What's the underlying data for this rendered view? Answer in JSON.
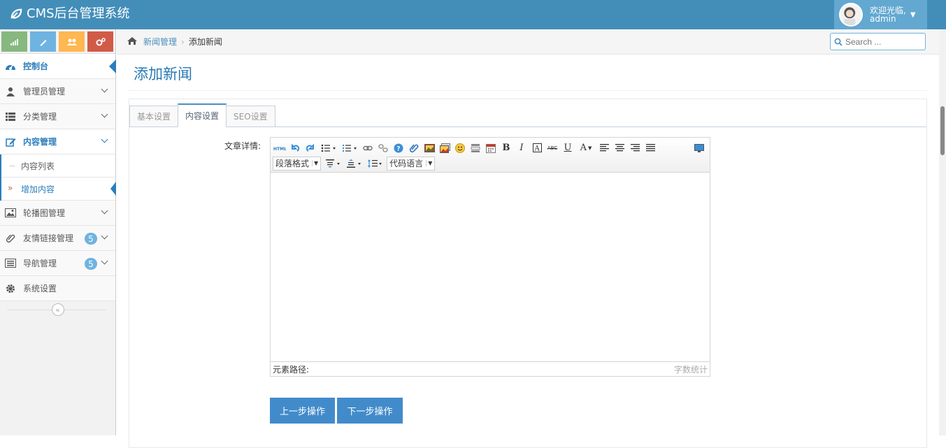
{
  "app": {
    "title": "CMS后台管理系统"
  },
  "user": {
    "greeting": "欢迎光临,",
    "name": "admin"
  },
  "colors": {
    "navbar": "#438eb9",
    "accent": "#2b7dbc",
    "button": "#428bca"
  },
  "shortcuts": [
    {
      "icon": "signal-icon",
      "color": "#87b87f"
    },
    {
      "icon": "pencil-icon",
      "color": "#6fb3e0"
    },
    {
      "icon": "users-icon",
      "color": "#ffb752"
    },
    {
      "icon": "cogs-icon",
      "color": "#d15b47"
    }
  ],
  "sidebar": {
    "items": [
      {
        "label": "控制台",
        "icon": "dashboard-icon"
      },
      {
        "label": "管理员管理",
        "icon": "user-icon"
      },
      {
        "label": "分类管理",
        "icon": "list-icon"
      },
      {
        "label": "内容管理",
        "icon": "edit-icon"
      },
      {
        "label": "轮播图管理",
        "icon": "picture-icon"
      },
      {
        "label": "友情链接管理",
        "icon": "paperclip-icon",
        "badge": "5"
      },
      {
        "label": "导航管理",
        "icon": "list-alt-icon",
        "badge": "5"
      },
      {
        "label": "系统设置",
        "icon": "gear-icon"
      }
    ],
    "subitems": [
      {
        "label": "内容列表"
      },
      {
        "label": "增加内容",
        "marker": "»"
      }
    ],
    "collapse_glyph": "«"
  },
  "breadcrumb": {
    "home_icon": "home-icon",
    "parent": "新闻管理",
    "sep": "›",
    "current": "添加新闻"
  },
  "search": {
    "placeholder": "Search ..."
  },
  "page": {
    "title": "添加新闻"
  },
  "tabs": [
    {
      "label": "基本设置"
    },
    {
      "label": "内容设置"
    },
    {
      "label": "SEO设置"
    }
  ],
  "form": {
    "content_label": "文章详情:"
  },
  "editor": {
    "selects": {
      "paragraph": "段落格式",
      "code_lang": "代码语言"
    },
    "bold": "B",
    "italic": "I",
    "underline": "U",
    "strike": "ABC",
    "fontcolor": "A",
    "path_label": "元素路径:",
    "word_count": "字数统计"
  },
  "buttons": {
    "prev": "上一步操作",
    "next": "下一步操作"
  }
}
